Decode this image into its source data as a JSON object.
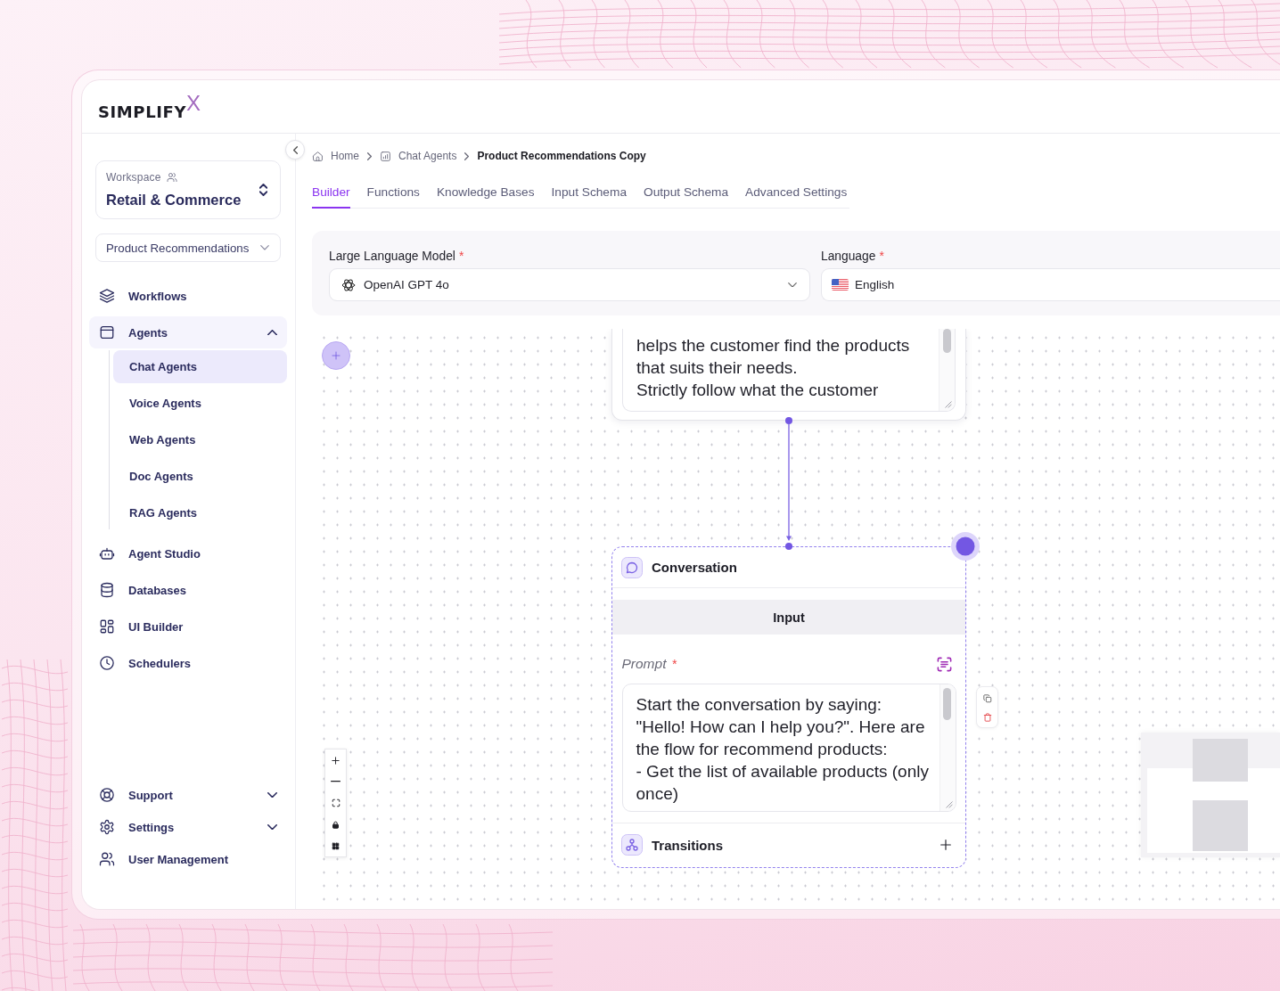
{
  "app": {
    "logo": "SIMPLIFY$^{X}$"
  },
  "sidebar": {
    "workspace": {
      "label": "Workspace",
      "name": "Retail & Commerce"
    },
    "project": {
      "value": "Product Recommendations"
    },
    "nav": [
      {
        "label": "Workflows",
        "selected": false
      },
      {
        "label": "Agents",
        "selected": false,
        "expanded": true,
        "children": [
          {
            "label": "Chat Agents",
            "selected": true
          },
          {
            "label": "Voice Agents",
            "selected": false
          },
          {
            "label": "Web Agents",
            "selected": false
          },
          {
            "label": "Doc Agents",
            "selected": false
          },
          {
            "label": "RAG Agents",
            "selected": false
          }
        ]
      },
      {
        "label": "Agent Studio",
        "selected": false
      },
      {
        "label": "Databases",
        "selected": false
      },
      {
        "label": "UI Builder",
        "selected": false
      },
      {
        "label": "Schedulers",
        "selected": false
      }
    ],
    "footer_nav": [
      {
        "label": "Support",
        "selected": false,
        "expanded": false
      },
      {
        "label": "Settings",
        "selected": false,
        "expanded": false
      },
      {
        "label": "User Management",
        "selected": false
      }
    ]
  },
  "breadcrumb": [
    {
      "label": "Home",
      "current": false
    },
    {
      "label": "Chat Agents",
      "current": false
    },
    {
      "label": "Product Recommendations Copy",
      "current": true
    }
  ],
  "tabs": [
    {
      "label": "Builder",
      "selected": true
    },
    {
      "label": "Functions",
      "selected": false
    },
    {
      "label": "Knowledge Bases",
      "selected": false
    },
    {
      "label": "Input Schema",
      "selected": false
    },
    {
      "label": "Output Schema",
      "selected": false
    },
    {
      "label": "Advanced Settings",
      "selected": false
    }
  ],
  "agent_settings": {
    "model": {
      "label": "Large Language Model",
      "required_mark": "*",
      "value": "OpenAI GPT 4o"
    },
    "language": {
      "label": "Language",
      "required_mark": "*",
      "value": "English"
    }
  },
  "canvas": {
    "nodes": [
      {
        "kind": "prompt",
        "selected": false,
        "text": "helps the customer find the products\nthat suits their needs.\nStrictly follow what the customer"
      },
      {
        "kind": "conversation",
        "selected": true,
        "title": "Conversation",
        "section": "Input",
        "prompt_label": "Prompt",
        "required_mark": "*",
        "prompt": "Start the conversation by saying:\n\"Hello! How can I help you?\". Here are\nthe flow for recommend products:\n- Get the list of available products (only\nonce)",
        "transitions_label": "Transitions"
      }
    ]
  }
}
